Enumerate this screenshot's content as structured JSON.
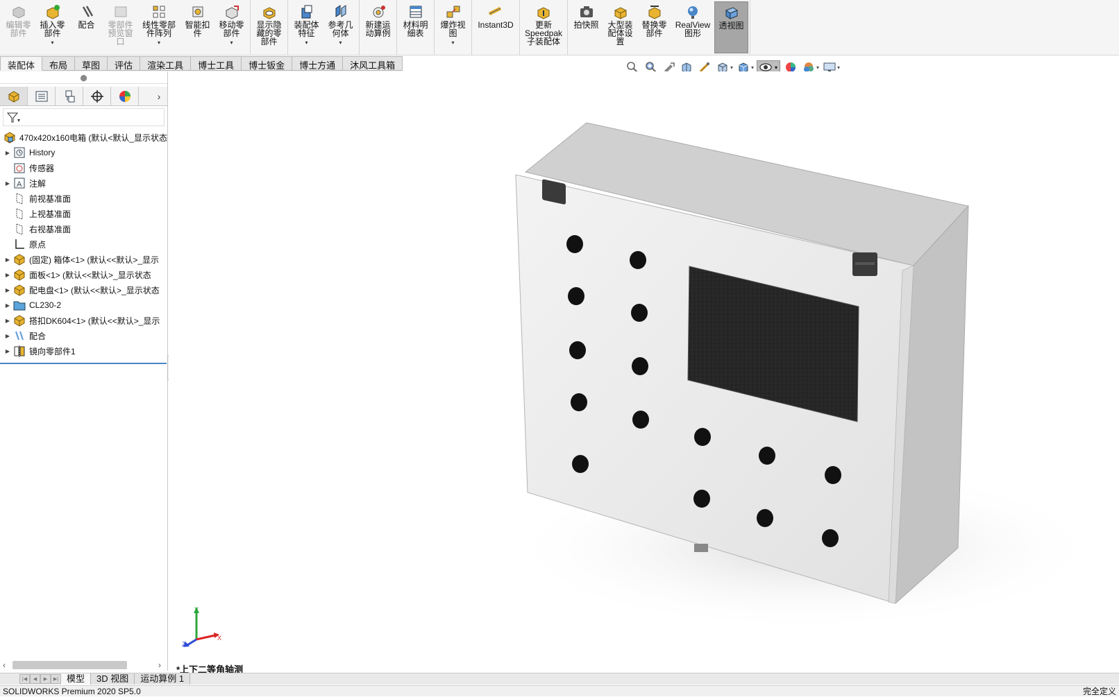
{
  "ribbon": {
    "groups": [
      [
        {
          "label": "编辑零\n部件",
          "icon": "edit-component-icon",
          "disabled": true
        },
        {
          "label": "插入零\n部件",
          "icon": "insert-component-icon",
          "dropdown": true
        },
        {
          "label": "配合",
          "icon": "mate-icon"
        },
        {
          "label": "零部件\n预览窗\n口",
          "icon": "component-preview-icon",
          "disabled": true
        },
        {
          "label": "线性零部\n件阵列",
          "icon": "linear-pattern-icon",
          "dropdown": true,
          "wide": true
        },
        {
          "label": "智能扣\n件",
          "icon": "smart-fasteners-icon"
        },
        {
          "label": "移动零\n部件",
          "icon": "move-component-icon",
          "dropdown": true
        }
      ],
      [
        {
          "label": "显示隐\n藏的零\n部件",
          "icon": "show-hidden-icon"
        }
      ],
      [
        {
          "label": "装配体\n特征",
          "icon": "assembly-features-icon",
          "dropdown": true
        },
        {
          "label": "参考几\n何体",
          "icon": "reference-geometry-icon",
          "dropdown": true
        }
      ],
      [
        {
          "label": "新建运\n动算例",
          "icon": "new-motion-study-icon"
        }
      ],
      [
        {
          "label": "材料明\n细表",
          "icon": "bill-of-materials-icon"
        }
      ],
      [
        {
          "label": "爆炸视\n图",
          "icon": "exploded-view-icon",
          "dropdown": true
        }
      ],
      [
        {
          "label": "Instant3D",
          "icon": "instant3d-icon",
          "xwide": true
        }
      ],
      [
        {
          "label": "更新\nSpeedpak\n子装配体",
          "icon": "speedpak-icon",
          "xwide": true
        }
      ],
      [
        {
          "label": "拍快照",
          "icon": "snapshot-icon"
        },
        {
          "label": "大型装\n配体设\n置",
          "icon": "large-assembly-icon"
        },
        {
          "label": "替换零\n部件",
          "icon": "replace-component-icon"
        },
        {
          "label": "RealView\n图形",
          "icon": "realview-icon",
          "wide": true
        },
        {
          "label": "透视图",
          "icon": "perspective-icon",
          "active": true
        }
      ]
    ]
  },
  "tabs": [
    "装配体",
    "布局",
    "草图",
    "评估",
    "渲染工具",
    "博士工具",
    "博士钣金",
    "博士方通",
    "沐风工具箱"
  ],
  "headsup_icons": [
    "zoom-to-fit-icon",
    "zoom-area-icon",
    "previous-view-icon",
    "section-view-icon",
    "dynamic-annotation-icon",
    "view-orientation-icon",
    "display-style-icon",
    "hide-show-items-icon",
    "edit-appearance-icon",
    "apply-scene-icon",
    "view-settings-icon"
  ],
  "panel": {
    "tabs": [
      "feature-manager-icon",
      "property-manager-icon",
      "configuration-manager-icon",
      "dimxpert-icon",
      "display-manager-icon"
    ],
    "root": "470x420x160电箱  (默认<默认_显示状态",
    "tree": [
      {
        "label": "History",
        "icon": "history-icon",
        "expandable": true
      },
      {
        "label": "传感器",
        "icon": "sensor-icon",
        "expandable": false
      },
      {
        "label": "注解",
        "icon": "annotation-icon",
        "expandable": true
      },
      {
        "label": "前视基准面",
        "icon": "plane-icon",
        "expandable": false
      },
      {
        "label": "上视基准面",
        "icon": "plane-icon",
        "expandable": false
      },
      {
        "label": "右视基准面",
        "icon": "plane-icon",
        "expandable": false
      },
      {
        "label": "原点",
        "icon": "origin-icon",
        "expandable": false
      },
      {
        "label": "(固定) 箱体<1> (默认<<默认>_显示",
        "icon": "part-icon",
        "expandable": true
      },
      {
        "label": "面板<1> (默认<<默认>_显示状态",
        "icon": "part-icon",
        "expandable": true
      },
      {
        "label": "配电盘<1> (默认<<默认>_显示状态",
        "icon": "part-icon",
        "expandable": true
      },
      {
        "label": "CL230-2",
        "icon": "folder-icon",
        "expandable": true
      },
      {
        "label": "搭扣DK604<1> (默认<<默认>_显示",
        "icon": "part-icon",
        "expandable": true
      },
      {
        "label": "配合",
        "icon": "mates-folder-icon",
        "expandable": true
      },
      {
        "label": "镜向零部件1",
        "icon": "mirror-component-icon",
        "expandable": true
      }
    ]
  },
  "viewport": {
    "view_name": "*上下二等角轴测",
    "triad": {
      "x": "X",
      "y": "Y",
      "z": "Z"
    }
  },
  "bottom_tabs": [
    "模型",
    "3D 视图",
    "运动算例 1"
  ],
  "status": {
    "left": "SOLIDWORKS Premium 2020 SP5.0",
    "right": "完全定义"
  },
  "colors": {
    "accent": "#4a86c8",
    "part_yellow": "#e8b431",
    "box_light": "#ebebeb",
    "box_shadow": "#c9c9c9",
    "window": "#2a2a2a"
  }
}
